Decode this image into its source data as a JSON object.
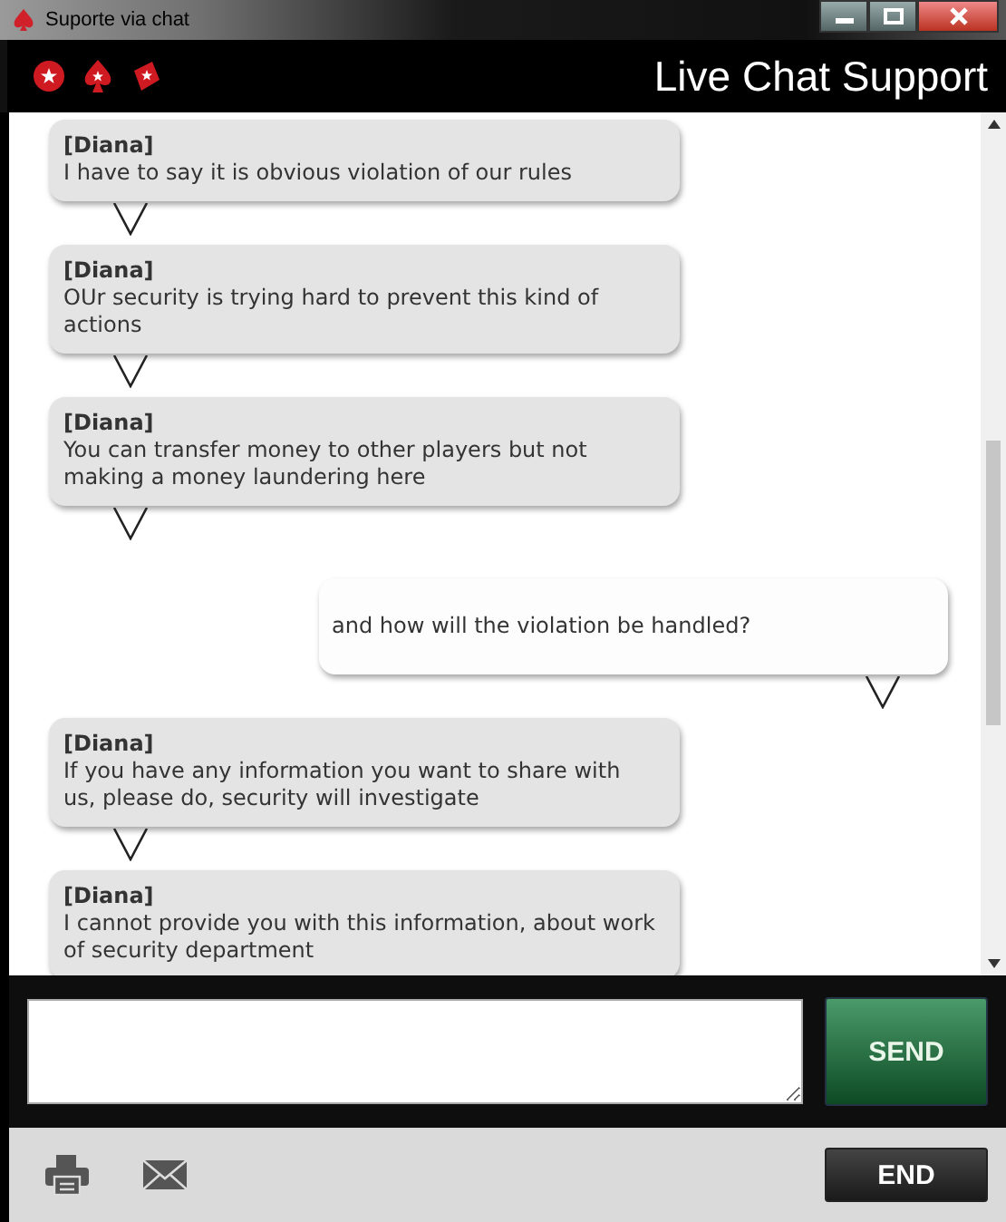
{
  "window": {
    "title": "Suporte via chat"
  },
  "header": {
    "title": "Live Chat Support"
  },
  "messages": [
    {
      "kind": "agent",
      "sender": "[Diana]",
      "text": "I have to say it is obvious violation of our rules"
    },
    {
      "kind": "agent",
      "sender": "[Diana]",
      "text": "OUr security is trying hard to prevent this kind of actions"
    },
    {
      "kind": "agent",
      "sender": "[Diana]",
      "text": "You can transfer money to other players but not making a money laundering here"
    },
    {
      "kind": "user",
      "text": "and how will the violation be handled?"
    },
    {
      "kind": "agent",
      "sender": "[Diana]",
      "text": "If you have any information you want to share with us, please do, security will investigate"
    },
    {
      "kind": "agent",
      "sender": "[Diana]",
      "text": "I cannot provide you with this information, about work of security department"
    }
  ],
  "composer": {
    "send_button": "SEND"
  },
  "footer": {
    "end_button": "END"
  }
}
